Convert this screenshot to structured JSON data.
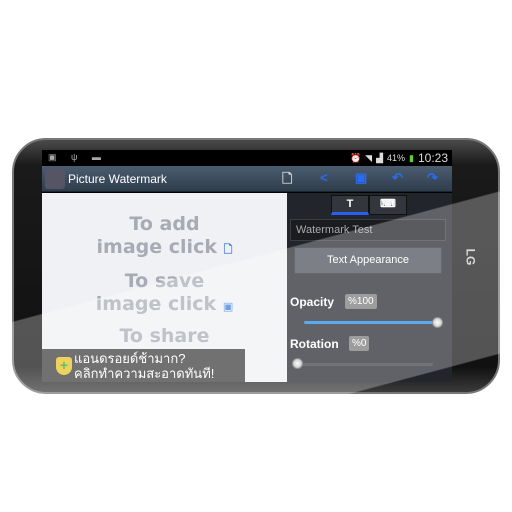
{
  "status": {
    "battery": "41%",
    "time": "10:23"
  },
  "actionbar": {
    "title": "Picture Watermark",
    "actions": [
      "add-image",
      "share",
      "save",
      "undo",
      "redo"
    ]
  },
  "canvas": {
    "hint1a": "To add",
    "hint1b": "image click",
    "hint2a": "To save",
    "hint2b": "image click",
    "hint3a": "To share"
  },
  "panel": {
    "tabs": [
      "T",
      "image"
    ],
    "watermark_text": "Watermark Test",
    "appearance_button": "Text Appearance",
    "opacity_label": "Opacity",
    "opacity_value": "%100",
    "opacity": 100,
    "rotation_label": "Rotation",
    "rotation_value": "%0",
    "rotation": 0
  },
  "ad": {
    "line1": "แอนดรอยด์ช้ามาก?",
    "line2": "คลิกทำความสะอาดทันที!"
  },
  "brand": "LG",
  "colors": {
    "accent": "#2a6cf0",
    "actionbar": "#3e4e60",
    "slider": "#1e88e5"
  }
}
